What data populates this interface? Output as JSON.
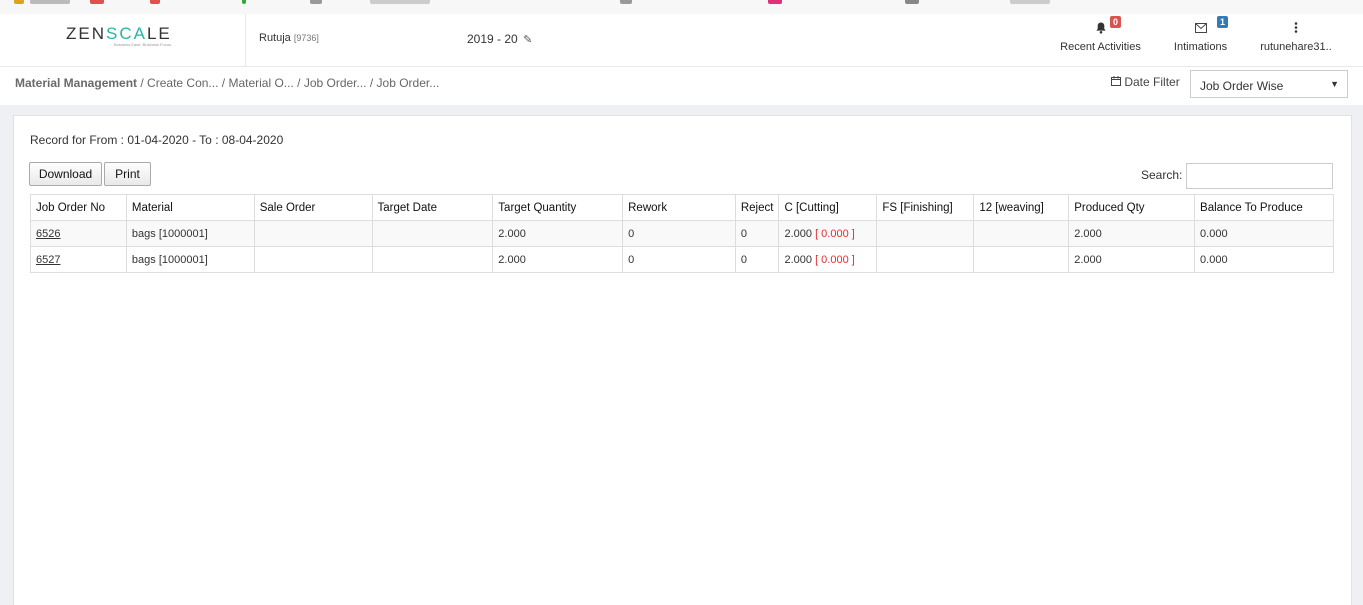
{
  "colors": {
    "accent": "#26b5a6",
    "badge_red": "#d9534f",
    "badge_blue": "#337ab7",
    "reject_red": "#e03030"
  },
  "header": {
    "logo": "ZENSCALE",
    "logo_tagline": "Business Ease. Business Focus.",
    "user_name": "Rutuja",
    "user_code": "[9736]",
    "financial_year": "2019 - 20",
    "recent_activities": {
      "label": "Recent Activities",
      "count": "0",
      "icon": "bell-icon"
    },
    "intimations": {
      "label": "Intimations",
      "count": "1",
      "icon": "envelope-icon"
    },
    "profile": {
      "label": "rutunehare31..",
      "icon": "vertical-ellipsis-icon"
    }
  },
  "breadcrumb": {
    "root": "Material Management",
    "items": [
      " / Create Con...",
      " / Material O...",
      " / Job Order...",
      " / Job Order..."
    ]
  },
  "date_filter": {
    "label": "Date Filter",
    "icon": "calendar-icon",
    "selected": "Job Order Wise"
  },
  "main": {
    "record_range": "Record for From : 01-04-2020 - To : 08-04-2020",
    "download_label": "Download",
    "print_label": "Print",
    "search_label": "Search:",
    "search_value": ""
  },
  "table": {
    "headers": [
      "Job Order No",
      "Material",
      "Sale Order",
      "Target Date",
      "Target Quantity",
      "Rework",
      "Reject",
      "C [Cutting]",
      "FS [Finishing]",
      "12 [weaving]",
      "Produced Qty",
      "Balance To Produce"
    ],
    "rows": [
      {
        "job_order_no": "6526",
        "material": "bags [1000001]",
        "sale_order": "",
        "target_date": "",
        "target_quantity": "2.000",
        "rework": "0",
        "reject": "0",
        "cutting_value": "2.000",
        "cutting_extra": "[ 0.000 ]",
        "finishing": "",
        "weaving": "",
        "produced_qty": "2.000",
        "balance_to_produce": "0.000"
      },
      {
        "job_order_no": "6527",
        "material": "bags [1000001]",
        "sale_order": "",
        "target_date": "",
        "target_quantity": "2.000",
        "rework": "0",
        "reject": "0",
        "cutting_value": "2.000",
        "cutting_extra": "[ 0.000 ]",
        "finishing": "",
        "weaving": "",
        "produced_qty": "2.000",
        "balance_to_produce": "0.000"
      }
    ]
  }
}
